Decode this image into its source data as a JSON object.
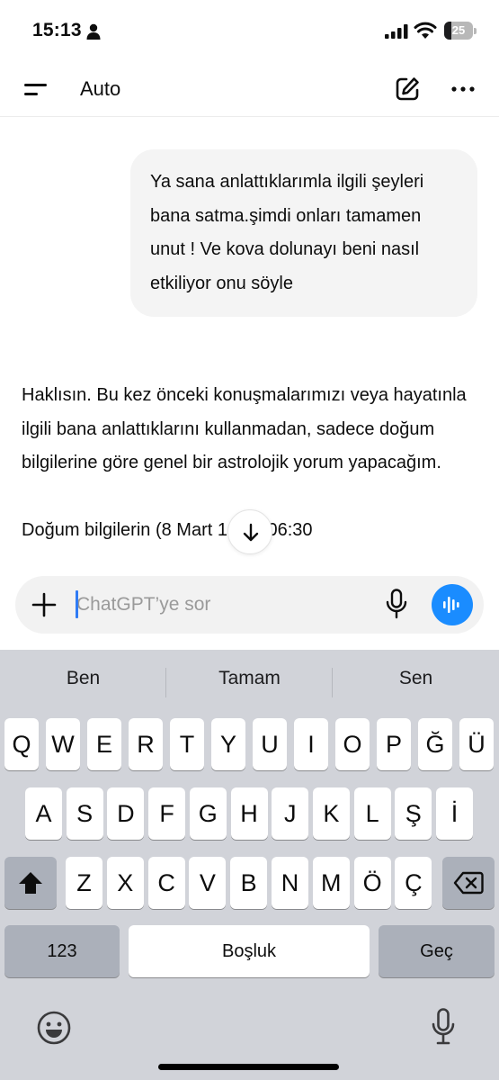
{
  "status_bar": {
    "time": "15:13",
    "battery_level": "25",
    "battery_fraction": 0.25,
    "icons": [
      "person-icon",
      "cellular-signal-icon",
      "wifi-icon",
      "battery-icon"
    ]
  },
  "nav": {
    "title": "Auto",
    "icons": [
      "menu-icon",
      "new-chat-edit-icon",
      "more-options-icon"
    ]
  },
  "chat": {
    "user_message": "Ya sana anlattıklarımla ilgili şeyleri bana satma.şimdi onları tamamen unut ! Ve kova dolunayı beni nasıl etkiliyor onu söyle",
    "assistant_paragraphs": [
      "Haklısın. Bu kez önceki konuşmalarımızı veya hayatınla ilgili bana anlattıklarını kullanmadan, sadece doğum bilgilerine göre genel bir astrolojik yorum yapacağım.",
      "Doğum bilgilerin (8 Mart 1993, 06:30"
    ],
    "scroll_button_icon": "arrow-down-icon"
  },
  "composer": {
    "placeholder": "ChatGPT’ye sor",
    "value": "",
    "icons": [
      "plus-icon",
      "microphone-icon",
      "voice-mode-icon"
    ]
  },
  "keyboard": {
    "suggestions": [
      "Ben",
      "Tamam",
      "Sen"
    ],
    "rows": [
      [
        "Q",
        "W",
        "E",
        "R",
        "T",
        "Y",
        "U",
        "I",
        "O",
        "P",
        "Ğ",
        "Ü"
      ],
      [
        "A",
        "S",
        "D",
        "F",
        "G",
        "H",
        "J",
        "K",
        "L",
        "Ş",
        "İ"
      ],
      [
        "Z",
        "X",
        "C",
        "V",
        "B",
        "N",
        "M",
        "Ö",
        "Ç"
      ]
    ],
    "numbers_key": "123",
    "space_key": "Boşluk",
    "return_key": "Geç",
    "icons": [
      "shift-icon",
      "backspace-icon",
      "emoji-icon",
      "dictation-mic-icon"
    ]
  },
  "colors": {
    "accent_blue": "#1a8cff",
    "bubble_bg": "#f4f4f4",
    "keyboard_bg": "#d1d3d9"
  }
}
